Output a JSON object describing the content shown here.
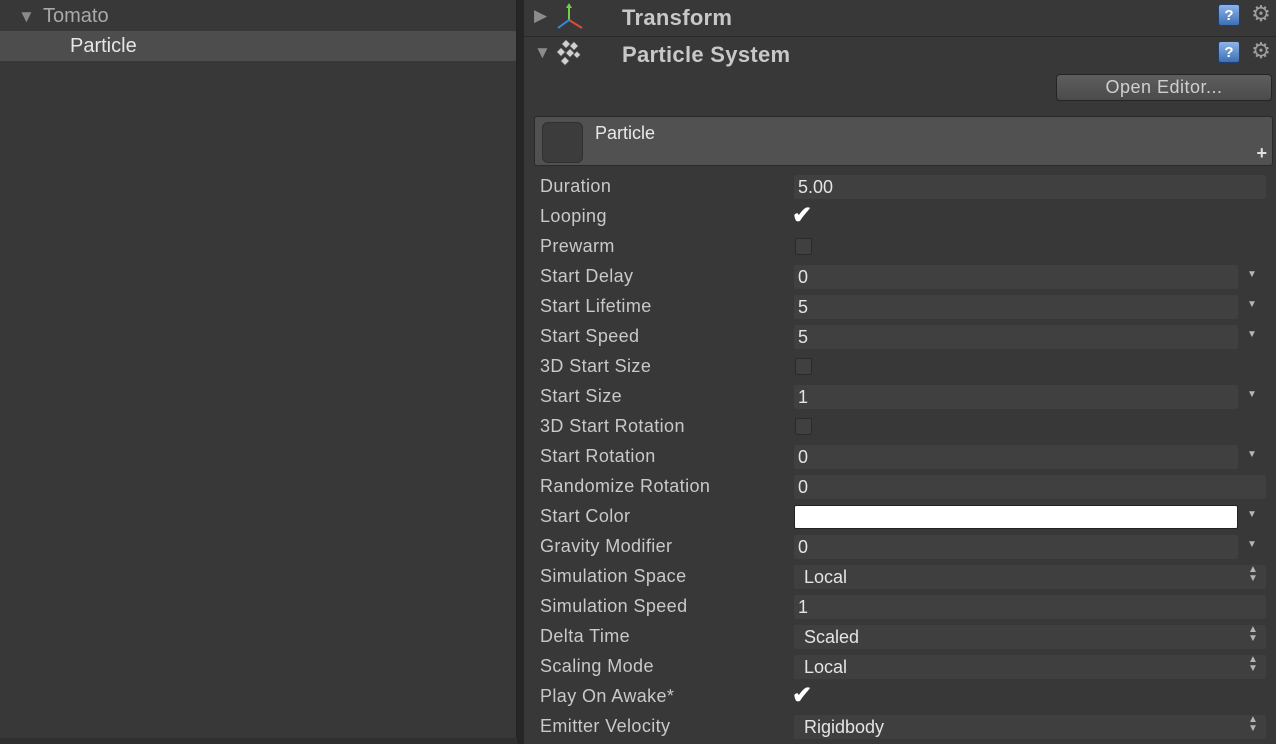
{
  "hierarchy": {
    "items": [
      {
        "label": "Tomato",
        "expanded": true
      },
      {
        "label": "Particle",
        "selected": true
      }
    ]
  },
  "inspector": {
    "components": [
      {
        "title": "Transform",
        "expanded": false
      },
      {
        "title": "Particle System",
        "expanded": true
      }
    ],
    "help_label": "?",
    "gear_icon": "gear-icon",
    "open_editor_label": "Open Editor...",
    "module_title": "Particle",
    "add_module_label": "+"
  },
  "properties": [
    {
      "label": "Duration",
      "type": "text",
      "value": "5.00"
    },
    {
      "label": "Looping",
      "type": "checkbox",
      "checked": true
    },
    {
      "label": "Prewarm",
      "type": "checkbox",
      "checked": false
    },
    {
      "label": "Start Delay",
      "type": "curve",
      "value": "0"
    },
    {
      "label": "Start Lifetime",
      "type": "curve",
      "value": "5"
    },
    {
      "label": "Start Speed",
      "type": "curve",
      "value": "5"
    },
    {
      "label": "3D Start Size",
      "type": "checkbox",
      "checked": false
    },
    {
      "label": "Start Size",
      "type": "curve",
      "value": "1"
    },
    {
      "label": "3D Start Rotation",
      "type": "checkbox",
      "checked": false
    },
    {
      "label": "Start Rotation",
      "type": "curve",
      "value": "0"
    },
    {
      "label": "Randomize Rotation",
      "type": "text",
      "value": "0"
    },
    {
      "label": "Start Color",
      "type": "color",
      "value": "#ffffff"
    },
    {
      "label": "Gravity Modifier",
      "type": "curve",
      "value": "0"
    },
    {
      "label": "Simulation Space",
      "type": "enum",
      "value": "Local"
    },
    {
      "label": "Simulation Speed",
      "type": "text",
      "value": "1"
    },
    {
      "label": "Delta Time",
      "type": "enum",
      "value": "Scaled"
    },
    {
      "label": "Scaling Mode",
      "type": "enum",
      "value": "Local"
    },
    {
      "label": "Play On Awake*",
      "type": "checkbox",
      "checked": true
    },
    {
      "label": "Emitter Velocity",
      "type": "enum",
      "value": "Rigidbody"
    }
  ]
}
